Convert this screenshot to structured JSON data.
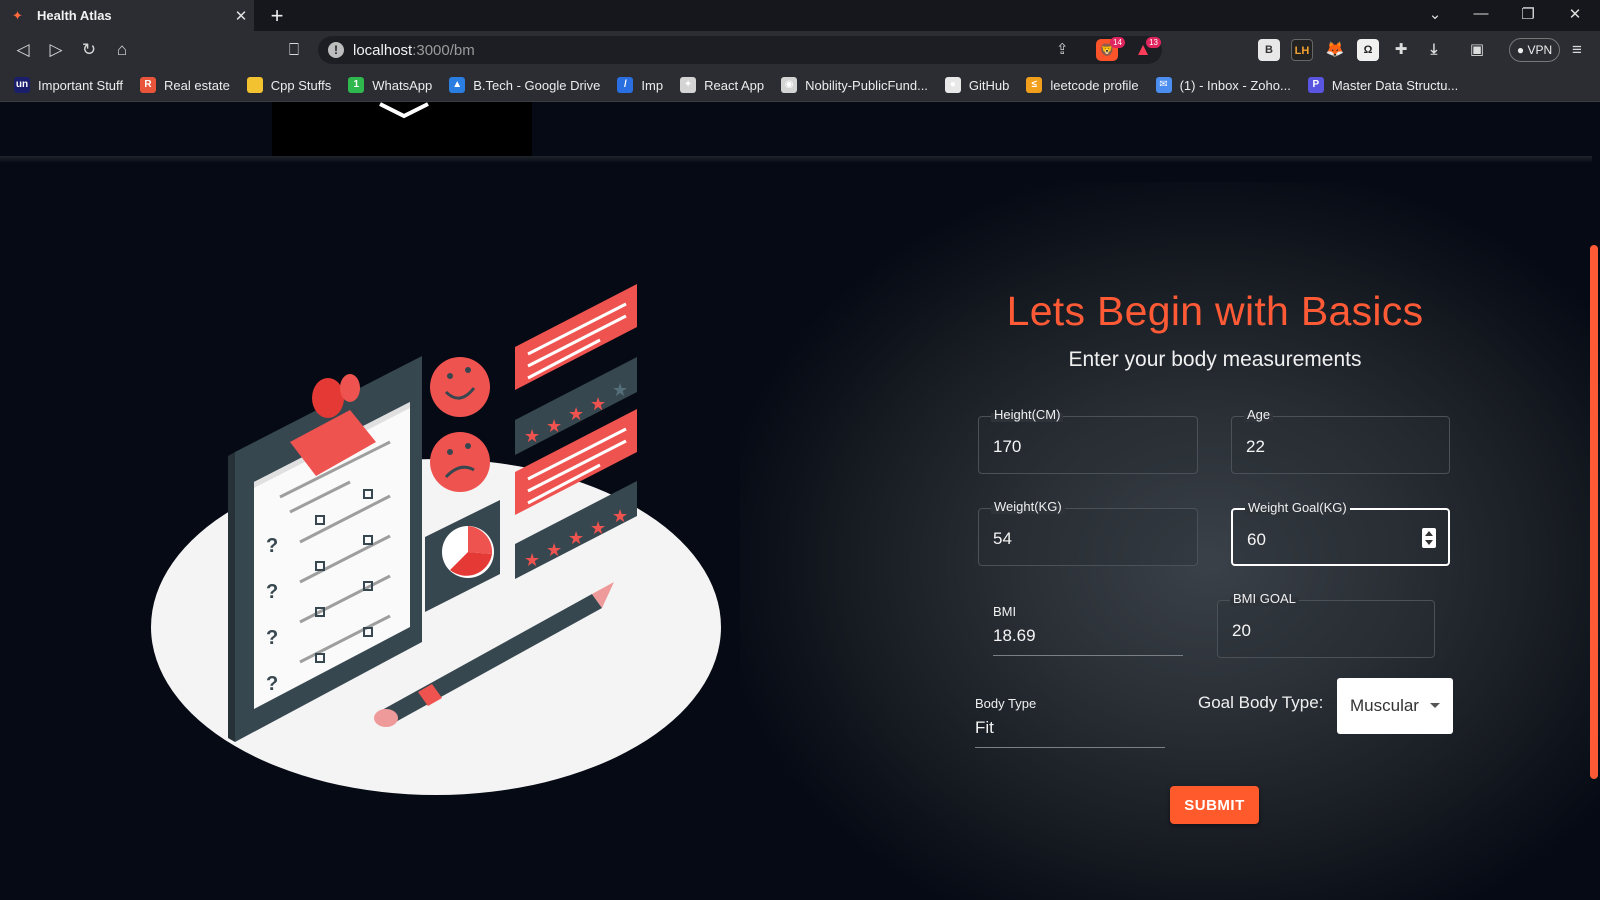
{
  "browser": {
    "tab_title": "Health Atlas",
    "tab_close": "✕",
    "new_tab": "+",
    "window_controls": [
      "⌄",
      "—",
      "❐",
      "✕"
    ],
    "url_host": "localhost",
    "url_path": ":3000/bm",
    "brave_shields_count": "14",
    "rewards_count": "13",
    "vpn_label": "VPN",
    "bookmarks": [
      {
        "label": "Important Stuff",
        "icon_text": "un",
        "color": "#1a1e6b"
      },
      {
        "label": "Real estate",
        "icon_text": "R",
        "color": "#e8553a"
      },
      {
        "label": "Cpp Stuffs",
        "icon_text": "",
        "color": "#f2c230"
      },
      {
        "label": "WhatsApp",
        "icon_text": "1",
        "color": "#2fb84d"
      },
      {
        "label": "B.Tech - Google Drive",
        "icon_text": "▲",
        "color": "#2a7de1"
      },
      {
        "label": "Imp",
        "icon_text": "/",
        "color": "#2a6fe1"
      },
      {
        "label": "React App",
        "icon_text": "✦",
        "color": "#d4d4d4"
      },
      {
        "label": "Nobility-PublicFund...",
        "icon_text": "◉",
        "color": "#d4d4d4"
      },
      {
        "label": "GitHub",
        "icon_text": "●",
        "color": "#e8e8e8"
      },
      {
        "label": "leetcode profile",
        "icon_text": "≤",
        "color": "#f29f1c"
      },
      {
        "label": "(1) - Inbox - Zoho...",
        "icon_text": "✉",
        "color": "#4c8df0"
      },
      {
        "label": "Master Data Structu...",
        "icon_text": "P",
        "color": "#5a55e0"
      }
    ]
  },
  "form": {
    "heading": "Lets Begin with Basics",
    "subheading": "Enter your body measurements",
    "height": {
      "label": "Height(CM)",
      "value": "170"
    },
    "age": {
      "label": "Age",
      "value": "22"
    },
    "weight": {
      "label": "Weight(KG)",
      "value": "54"
    },
    "weight_goal": {
      "label": "Weight Goal(KG)",
      "value": "60"
    },
    "bmi": {
      "label": "BMI",
      "value": "18.69"
    },
    "bmi_goal": {
      "label": "BMI GOAL",
      "value": "20"
    },
    "body_type": {
      "label": "Body Type",
      "value": "Fit"
    },
    "goal_body_type": {
      "label": "Goal Body Type:",
      "value": "Muscular"
    },
    "submit_label": "SUBMIT"
  },
  "colors": {
    "accent": "#ff5a36",
    "page_bg": "#050a14"
  }
}
